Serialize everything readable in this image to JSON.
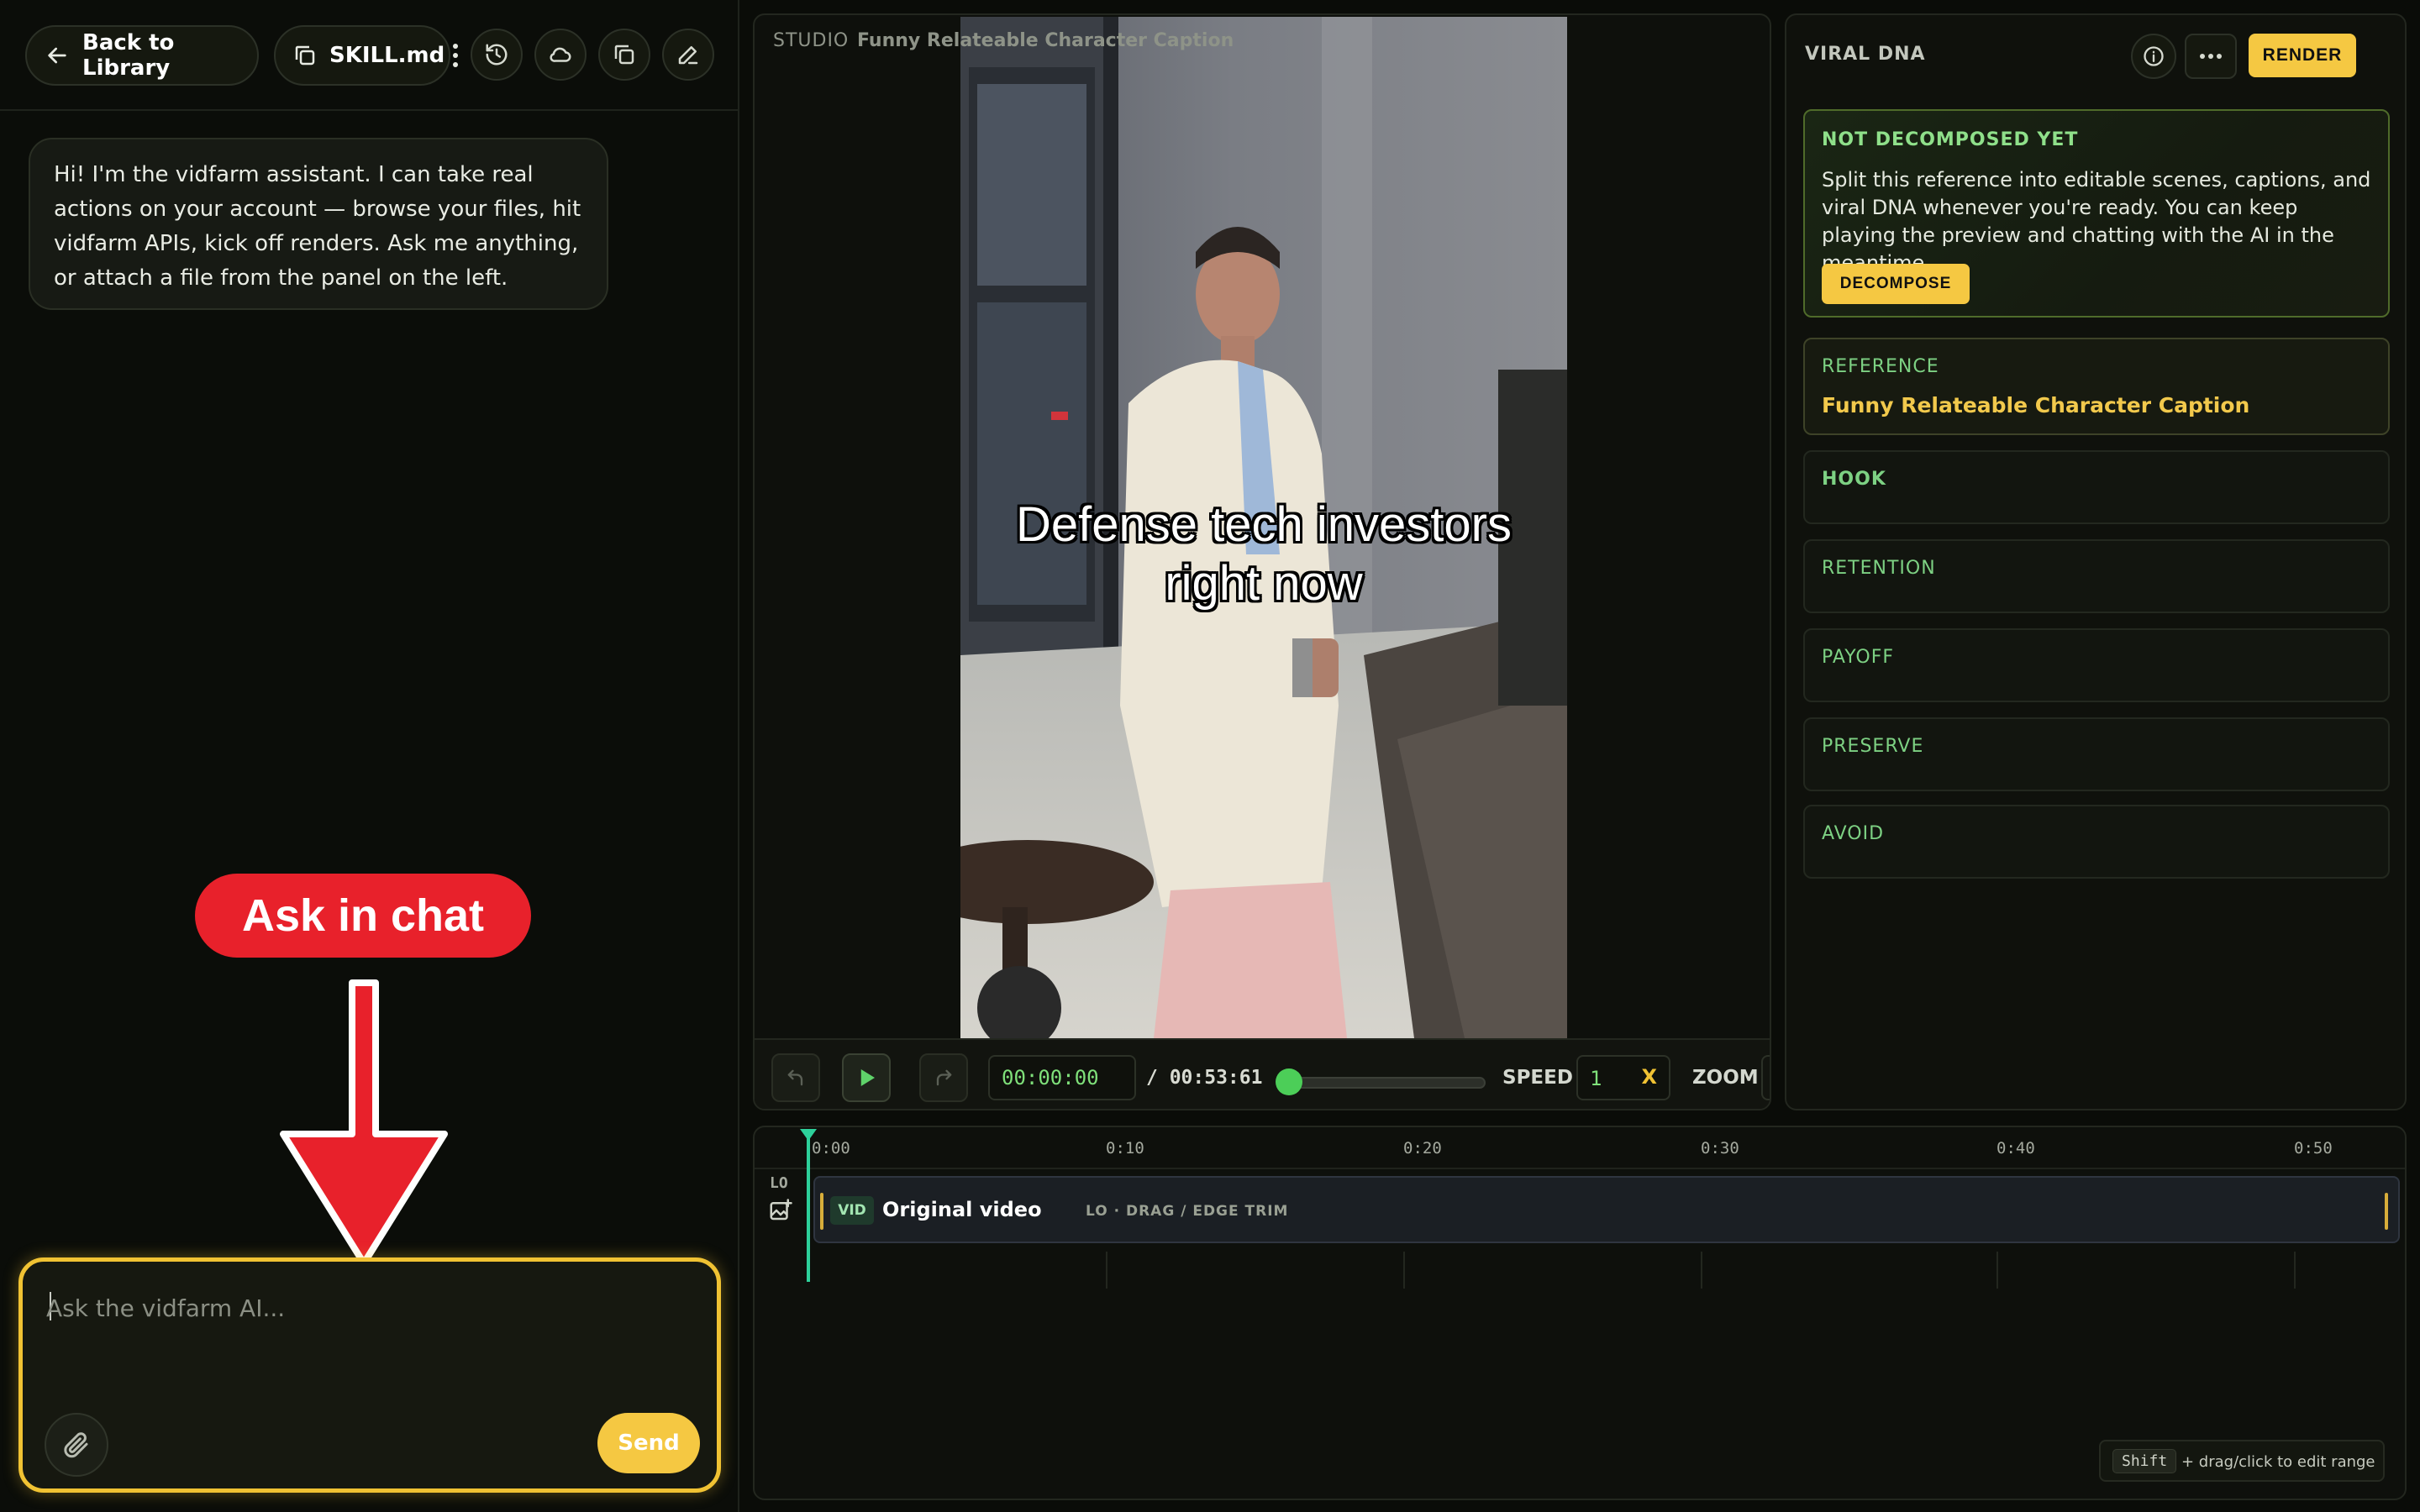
{
  "left": {
    "back_label": "Back to Library",
    "skill_label": "SKILL.md",
    "assistant_message": "Hi! I'm the vidfarm assistant. I can take real actions on your account — browse your files, hit vidfarm APIs, kick off renders. Ask me anything, or attach a file from the panel on the left.",
    "annotation": "Ask in chat",
    "chat_placeholder": "Ask the vidfarm AI...",
    "send_label": "Send"
  },
  "preview": {
    "studio_label": "STUDIO",
    "title": "Funny Relateable Character Caption",
    "caption_line1": "Defense tech investors",
    "caption_line2": "right now",
    "current_time": "00:00:00",
    "total_time": "/ 00:53:61",
    "playback_progress": 0,
    "speed_label": "SPEED",
    "speed_value": "1",
    "speed_unit": "X",
    "zoom_label": "ZOOM"
  },
  "right": {
    "title": "VIRAL DNA",
    "render_label": "RENDER",
    "not_decomposed_title": "NOT DECOMPOSED YET",
    "not_decomposed_desc": "Split this reference into editable scenes, captions, and viral DNA whenever you're ready. You can keep playing the preview and chatting with the AI in the meantime.",
    "decompose_label": "DECOMPOSE",
    "reference_label": "REFERENCE",
    "reference_title": "Funny Relateable Character Caption",
    "sections": [
      "HOOK",
      "RETENTION",
      "PAYOFF",
      "PRESERVE",
      "AVOID"
    ]
  },
  "timeline": {
    "ticks": [
      "0:00",
      "0:10",
      "0:20",
      "0:30",
      "0:40",
      "0:50"
    ],
    "track_label": "LO",
    "clip_badge": "VID",
    "clip_title": "Original video",
    "clip_subtitle": "LO · DRAG / EDGE TRIM",
    "hint_key": "Shift",
    "hint_text": "+ drag/click to edit range"
  },
  "colors": {
    "accent_yellow": "#f5c842",
    "accent_green": "#7dd183",
    "annotation_red": "#e8212b",
    "playhead": "#2dd19b"
  }
}
